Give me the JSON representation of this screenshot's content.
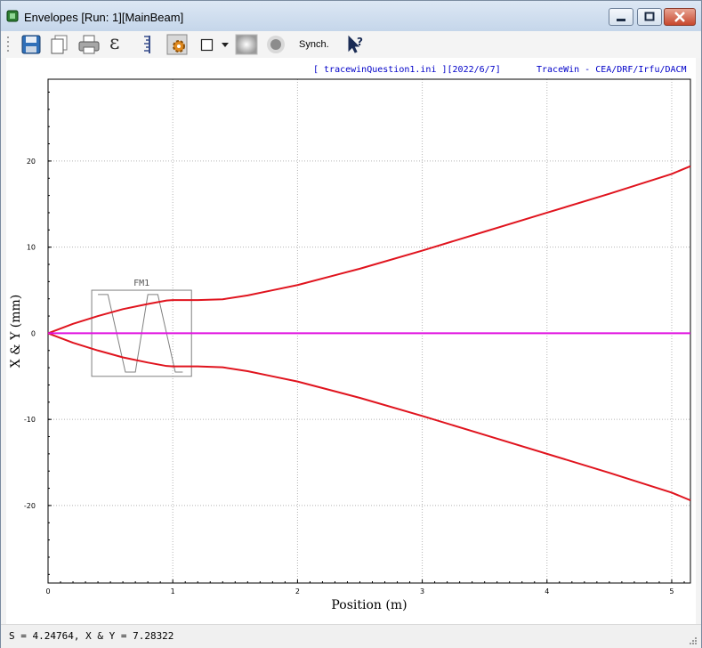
{
  "window": {
    "title": "Envelopes [Run: 1][MainBeam]"
  },
  "toolbar": {
    "items": [
      {
        "name": "save-icon",
        "icon": "floppy-disk"
      },
      {
        "name": "copy-icon",
        "icon": "documents"
      },
      {
        "name": "print-icon",
        "icon": "printer"
      },
      {
        "name": "emittance-icon",
        "icon": "epsilon",
        "glyph": "ε"
      },
      {
        "name": "scale-icon",
        "icon": "ruler-bracket"
      },
      {
        "name": "settings-icon",
        "icon": "gear"
      },
      {
        "name": "frame-checkbox",
        "icon": "square"
      },
      {
        "name": "dropdown-arrow-icon",
        "icon": "triangle-down"
      },
      {
        "name": "beam-spot-icon",
        "icon": "radial-circle"
      },
      {
        "name": "beam-dot-icon",
        "icon": "grey-dot"
      }
    ],
    "synch_label": "Synch.",
    "help_icon": "pointer-question"
  },
  "plot": {
    "file_info": "[ tracewinQuestion1.ini ][2022/6/7]",
    "brand": "TraceWin - CEA/DRF/Irfu/DACM",
    "element_label": "FM1",
    "colors": {
      "envelope": "#e0141e",
      "centroid": "#e010e0",
      "element": "#808080",
      "grid": "#b4b4b4",
      "header": "#0000c8"
    }
  },
  "chart_data": {
    "type": "line",
    "xlabel": "Position (m)",
    "ylabel": "X & Y (mm)",
    "xlim": [
      0,
      5.15
    ],
    "ylim": [
      -29,
      29.5
    ],
    "x_ticks": [
      0,
      1,
      2,
      3,
      4,
      5
    ],
    "y_ticks": [
      -20,
      -10,
      0,
      10,
      20
    ],
    "grid": true,
    "series": [
      {
        "role": "upper",
        "x": [
          0,
          0.2,
          0.4,
          0.6,
          0.8,
          0.95,
          1.0,
          1.2,
          1.4,
          1.6,
          1.8,
          2.0,
          2.5,
          3.0,
          3.5,
          4.0,
          4.5,
          5.0,
          5.15
        ],
        "values": [
          0,
          1.1,
          2.0,
          2.8,
          3.4,
          3.8,
          3.85,
          3.85,
          3.95,
          4.4,
          5.0,
          5.6,
          7.5,
          9.6,
          11.8,
          14.0,
          16.2,
          18.5,
          19.4
        ]
      },
      {
        "role": "lower",
        "x": [
          0,
          0.2,
          0.4,
          0.6,
          0.8,
          0.95,
          1.0,
          1.2,
          1.4,
          1.6,
          1.8,
          2.0,
          2.5,
          3.0,
          3.5,
          4.0,
          4.5,
          5.0,
          5.15
        ],
        "values": [
          0,
          -1.1,
          -2.0,
          -2.8,
          -3.4,
          -3.8,
          -3.85,
          -3.85,
          -3.95,
          -4.4,
          -5.0,
          -5.6,
          -7.5,
          -9.6,
          -11.8,
          -14.0,
          -16.2,
          -18.5,
          -19.4
        ]
      },
      {
        "role": "centroid",
        "x": [
          0,
          5.15
        ],
        "values": [
          0,
          0
        ]
      }
    ],
    "element_box": {
      "label": "FM1",
      "x_range": [
        0.35,
        1.15
      ],
      "y_range": [
        -5,
        5
      ]
    },
    "field_profile": {
      "x": [
        0.4,
        0.48,
        0.62,
        0.7,
        0.8,
        0.88,
        1.02,
        1.08
      ],
      "values": [
        4.5,
        4.5,
        -4.5,
        -4.5,
        4.5,
        4.5,
        -4.5,
        -4.5
      ]
    }
  },
  "status": {
    "text": "S = 4.24764, X & Y = 7.28322"
  }
}
